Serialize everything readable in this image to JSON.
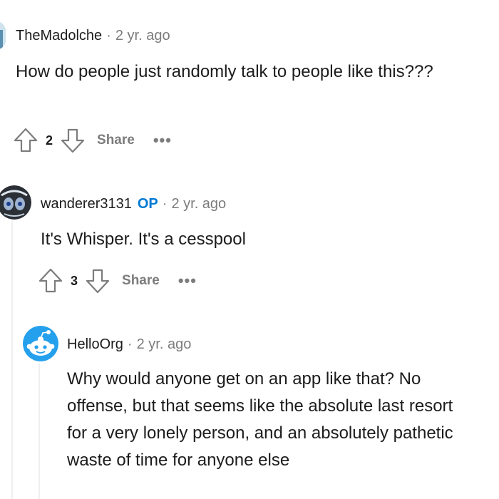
{
  "comments": [
    {
      "author": "TheMadolche",
      "time": "2 yr. ago",
      "body": "How do people just randomly talk to people like this???",
      "votes": "2",
      "share_label": "Share",
      "more_label": "•••"
    },
    {
      "author": "wanderer3131",
      "op_badge": "OP",
      "time": "2 yr. ago",
      "body": "It's Whisper. It's a cesspool",
      "votes": "3",
      "share_label": "Share",
      "more_label": "•••"
    },
    {
      "author": "HelloOrg",
      "time": "2 yr. ago",
      "body": "Why would anyone get on an app like that? No offense, but that seems like the absolute last resort for a very lonely person, and an absolutely pathetic waste of time for anyone else"
    }
  ],
  "separator": "·",
  "colors": {
    "text": "#1c1c1c",
    "meta": "#7c7c7c",
    "op": "#0079d3",
    "thread_line": "#edeff1",
    "snoo_avatar_bg": "#24a0ed"
  }
}
